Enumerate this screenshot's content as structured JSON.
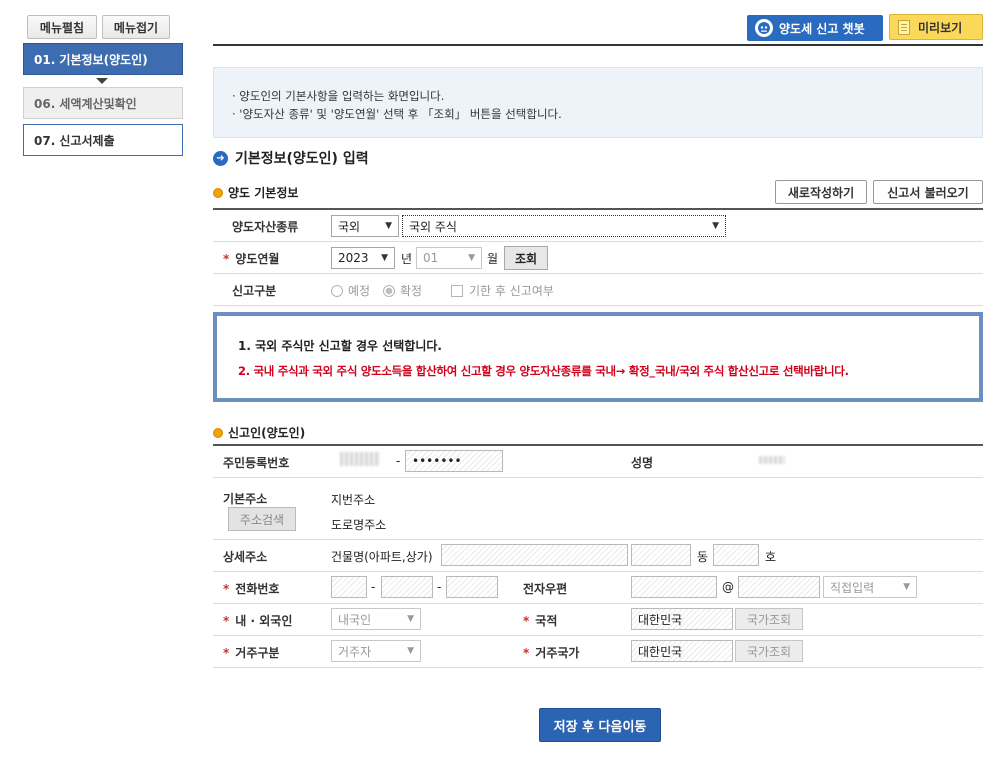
{
  "sidebar": {
    "expand_label": "메뉴펼침",
    "collapse_label": "메뉴접기",
    "steps": [
      {
        "label": "01. 기본정보(양도인)"
      },
      {
        "label": "06. 세액계산및확인"
      },
      {
        "label": "07. 신고서제출"
      }
    ]
  },
  "header": {
    "chatbot_label": "양도세 신고 챗봇",
    "preview_label": "미리보기"
  },
  "info": {
    "line1": "· 양도인의 기본사항을 입력하는 화면입니다.",
    "line2": "· '양도자산 종류' 및 '양도연월' 선택 후 「조회」 버튼을 선택합니다."
  },
  "main_title": "기본정보(양도인) 입력",
  "transfer_info": {
    "title": "양도 기본정보",
    "new_button": "새로작성하기",
    "load_button": "신고서 불러오기",
    "asset_type_label": "양도자산종류",
    "asset_type_value": "국외",
    "asset_detail_value": "국외 주식",
    "transfer_month_label": "양도연월",
    "year_value": "2023",
    "year_unit": "년",
    "month_value": "01",
    "month_unit": "월",
    "search_button": "조회",
    "report_type_label": "신고구분",
    "option_scheduled": "예정",
    "option_confirmed": "확정",
    "option_late": "기한 후 신고여부"
  },
  "notice": {
    "line1": "1. 국외 주식만 신고할 경우 선택합니다.",
    "line2": "2. 국내 주식과 국외 주식 양도소득을 합산하여 신고할 경우 양도자산종류를 국내→ 확정_국내/국외 주식 합산신고로 선택바랍니다."
  },
  "reporter": {
    "title": "신고인(양도인)",
    "rrn_label": "주민등록번호",
    "rrn_dash": "-",
    "rrn_back": "•••••••",
    "name_label": "성명",
    "address_label": "기본주소",
    "address_search_button": "주소검색",
    "jibun_label": "지번주소",
    "road_label": "도로명주소",
    "detail_address_label": "상세주소",
    "building_label": "건물명(아파트,상가)",
    "dong_unit": "동",
    "ho_unit": "호",
    "phone_label": "전화번호",
    "phone_dash1": "-",
    "phone_dash2": "-",
    "email_label": "전자우편",
    "email_at": "@",
    "email_domain_select": "직접입력",
    "nationality_type_label": "내 · 외국인",
    "nationality_type_value": "내국인",
    "nationality_label": "국적",
    "nationality_value": "대한민국",
    "country_search_button": "국가조회",
    "residency_label": "거주구분",
    "residency_value": "거주자",
    "residence_country_label": "거주국가",
    "residence_country_value": "대한민국",
    "country_search_button2": "국가조회"
  },
  "save_button": "저장 후 다음이동",
  "colors": {
    "primary_blue": "#2a64b3",
    "preview_yellow": "#fbd85a",
    "notice_red": "#d0021b",
    "required_red": "#c0392b"
  }
}
